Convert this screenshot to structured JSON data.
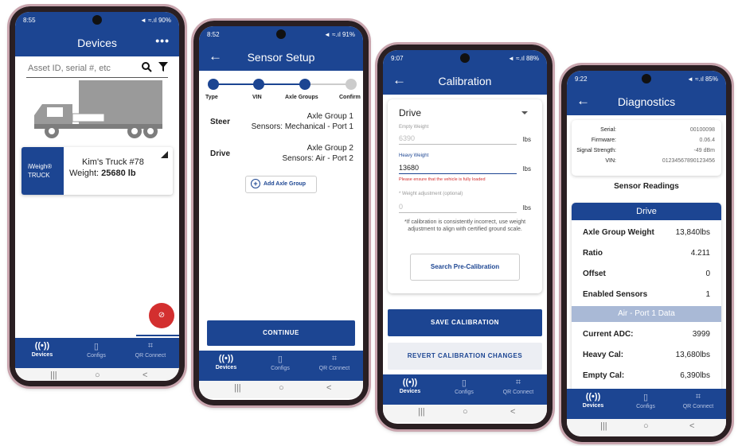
{
  "colors": {
    "primary": "#1c4592",
    "accent_red": "#d32f2f"
  },
  "nav_labels": {
    "devices": "Devices",
    "configs": "Configs",
    "qr": "QR Connect"
  },
  "nav_icons": {
    "devices": "((•))",
    "configs": "▯",
    "qr": "⌗"
  },
  "sys_nav": {
    "recent": "|||",
    "home": "○",
    "back": "<"
  },
  "screen1": {
    "status_time": "8:55",
    "status_right": "◄ ≈.ıl 90%",
    "title": "Devices",
    "more_icon": "•••",
    "search_placeholder": "Asset ID, serial #, etc",
    "card": {
      "brand_line1": "iWeigh®",
      "brand_line2": "TRUCK",
      "name": "Kim's Truck #78",
      "weight_label": "Weight:",
      "weight_value": "25680 lb"
    }
  },
  "screen2": {
    "status_time": "8:52",
    "status_right": "◄ ≈.ıl 91%",
    "title": "Sensor Setup",
    "steps": [
      "Type",
      "VIN",
      "Axle Groups",
      "Confirm"
    ],
    "groups": [
      {
        "label": "Steer",
        "line1": "Axle Group 1",
        "line2": "Sensors: Mechanical - Port 1"
      },
      {
        "label": "Drive",
        "line1": "Axle Group 2",
        "line2": "Sensors: Air - Port 2"
      }
    ],
    "add_axle": "Add Axle Group",
    "continue": "CONTINUE"
  },
  "screen3": {
    "status_time": "9:07",
    "status_right": "◄ ≈.ıl 88%",
    "title": "Calibration",
    "select_value": "Drive",
    "empty_label": "Empty Weight",
    "empty_value": "6390",
    "heavy_label": "Heavy Weight",
    "heavy_value": "13680",
    "unit": "lbs",
    "warning": "Please ensure that the vehicle is fully loaded",
    "adj_label": "* Weight adjustment (optional)",
    "adj_value": "0",
    "note": "*If calibration is consistently incorrect, use weight adjustment to align with certified ground scale.",
    "search_btn": "Search Pre-Calibration",
    "save_btn": "SAVE CALIBRATION",
    "revert_btn": "REVERT CALIBRATION CHANGES"
  },
  "screen4": {
    "status_time": "9:22",
    "status_right": "◄ ≈.ıl 85%",
    "title": "Diagnostics",
    "info": [
      {
        "k": "Serial:",
        "v": "00100098"
      },
      {
        "k": "Firmware:",
        "v": "0.06.4"
      },
      {
        "k": "Signal Strength:",
        "v": "-49 dBm"
      },
      {
        "k": "VIN:",
        "v": "01234567890123456"
      }
    ],
    "sensor_readings": "Sensor Readings",
    "drive_header": "Drive",
    "drive_rows": [
      {
        "k": "Axle Group Weight",
        "v": "13,840lbs"
      },
      {
        "k": "Ratio",
        "v": "4.211"
      },
      {
        "k": "Offset",
        "v": "0"
      },
      {
        "k": "Enabled Sensors",
        "v": "1"
      }
    ],
    "port_header": "Air - Port 1 Data",
    "port_rows": [
      {
        "k": "Current ADC:",
        "v": "3999"
      },
      {
        "k": "Heavy Cal:",
        "v": "13,680lbs"
      },
      {
        "k": "Empty Cal:",
        "v": "6,390lbs"
      }
    ]
  }
}
